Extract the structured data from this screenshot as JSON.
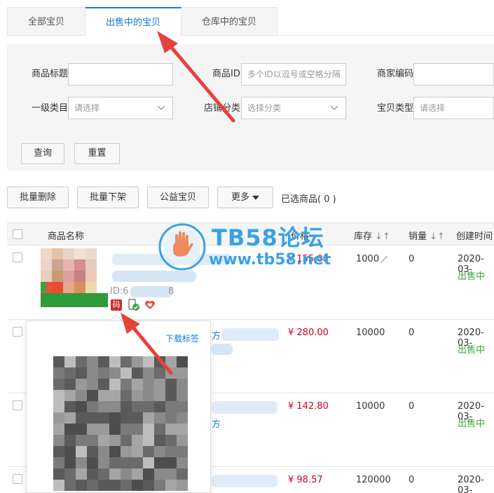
{
  "tabs": [
    {
      "label": "全部宝贝"
    },
    {
      "label": "出售中的宝贝"
    },
    {
      "label": "仓库中的宝贝"
    }
  ],
  "filters": {
    "title_label": "商品标题",
    "id_label": "商品ID",
    "id_placeholder": "多个ID以逗号或空格分隔",
    "code_label": "商家编码",
    "category_label": "一级类目",
    "category_placeholder": "请选择",
    "shop_category_label": "店铺分类",
    "shop_category_placeholder": "选择分类",
    "type_label": "宝贝类型",
    "type_placeholder": "请选择",
    "query_button": "查询",
    "reset_button": "重置"
  },
  "toolbar": {
    "batch_delete": "批量删除",
    "batch_offline": "批量下架",
    "charity": "公益宝贝",
    "more": "更多",
    "selected_text": "已选商品( 0 )"
  },
  "table": {
    "headers": {
      "name": "商品名称",
      "price": "价格",
      "stock": "库存",
      "sales": "销量",
      "created": "创建时间"
    },
    "rows": [
      {
        "title_fragment": "ID:6",
        "id_tail": "8",
        "price": "¥ 155.00",
        "stock": "1000",
        "sales": "0",
        "date": "2020-03-",
        "status": "出售中"
      },
      {
        "title_fragment": "方",
        "price": "¥ 280.00",
        "stock": "10000",
        "sales": "0",
        "date": "2020-03-",
        "status": "出售中"
      },
      {
        "title_fragment": "方",
        "price": "¥ 142.80",
        "stock": "10000",
        "sales": "0",
        "date": "2020-03-",
        "status": "出售中"
      },
      {
        "title_fragment": "",
        "price": "¥ 98.57",
        "stock": "120000",
        "sales": "0",
        "date": "2020-03-",
        "status": ""
      }
    ],
    "tag_icons": [
      "qrcode-tag-icon",
      "mobile-check-icon",
      "charity-heart-icon"
    ],
    "qr_tag_char": "码"
  },
  "popup": {
    "download_label": "下载标签"
  },
  "watermark": {
    "title": "TB58论坛",
    "url": "www.tb58.net"
  },
  "colors": {
    "accent": "#1a7ad6",
    "price": "#d0021b",
    "status": "#3aa83a",
    "arrow": "#e8413c"
  }
}
